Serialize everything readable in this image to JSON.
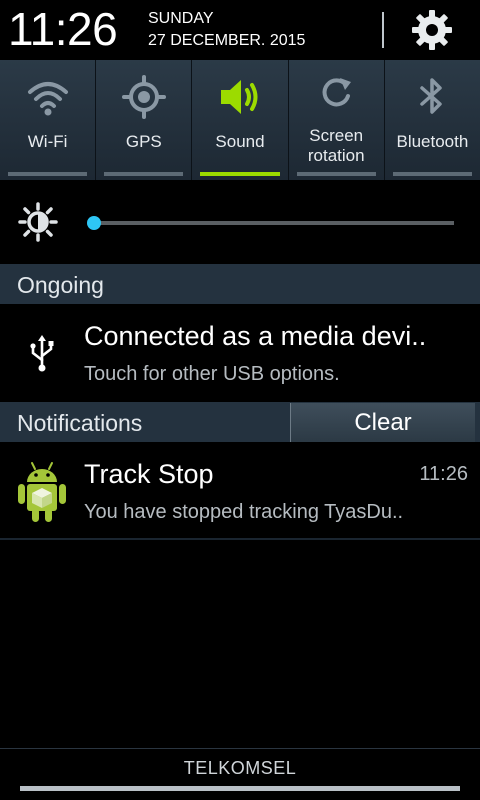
{
  "status": {
    "time": "11:26",
    "day": "SUNDAY",
    "date": "27 DECEMBER. 2015"
  },
  "quick_settings": [
    {
      "label": "Wi-Fi",
      "icon": "wifi-icon",
      "enabled": false
    },
    {
      "label": "GPS",
      "icon": "gps-icon",
      "enabled": false
    },
    {
      "label": "Sound",
      "icon": "sound-icon",
      "enabled": true
    },
    {
      "label": "Screen rotation",
      "icon": "rotation-icon",
      "enabled": false
    },
    {
      "label": "Bluetooth",
      "icon": "bluetooth-icon",
      "enabled": false
    }
  ],
  "brightness": {
    "level": 0.01
  },
  "ongoing": {
    "header": "Ongoing",
    "title": "Connected as a media devi..",
    "subtitle": "Touch for other USB options."
  },
  "notifications": {
    "header": "Notifications",
    "clear_label": "Clear",
    "items": [
      {
        "title": "Track Stop",
        "subtitle": "You have stopped tracking TyasDu..",
        "time": "11:26"
      }
    ]
  },
  "footer": {
    "carrier": "TELKOMSEL"
  },
  "colors": {
    "accent_on": "#9cdb00",
    "slider": "#1fb5e8",
    "panel": "#24323f"
  }
}
